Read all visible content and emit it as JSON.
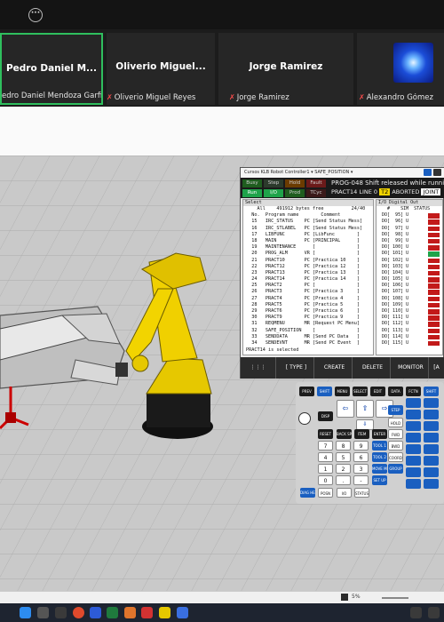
{
  "participants": [
    {
      "name": "Pedro  Daniel  M...",
      "label": "edro Daniel Mendoza Garfias",
      "muted": false
    },
    {
      "name": "Oliverio  Miguel...",
      "label": "Oliverio Miguel Reyes",
      "muted": true
    },
    {
      "name": "Jorge Ramirez",
      "label": "Jorge Ramirez",
      "muted": true
    },
    {
      "name": "",
      "label": "Alexandro Gómez",
      "muted": true
    }
  ],
  "pendant": {
    "title": "Cursos KLB   Robot Controller1 ▾   SAFE_POSITION ▾",
    "leds": [
      "Busy",
      "Step",
      "Hold",
      "Fault",
      "Run",
      "I/O",
      "Prod",
      "TCyc"
    ],
    "message1": "PROG-048 Shift released while running (P",
    "message2": "PRACT14 LINE 0",
    "t2": "T2",
    "aborted": "ABORTED",
    "joint": "JOINT",
    "select_header": "Select",
    "io_header": "I/O Digital Out",
    "prog_header": "    All    491912 bytes free          24/40",
    "prog_cols": "  No.  Program name        Comment",
    "programs": [
      "  15   IRC_STATUS    PC [Send Status Mess]",
      "  16   IRC_STLABEL   PC [Send Status Mess]",
      "  17   LIBFUNC       PC [LibFunc        ]",
      "  18   MAIN          PC [PRINCIPAL      ]",
      "  19   MAINTENANCE      [               ]",
      "  20   PROG_ALM      VR [               ]",
      "  21   PRACT10       PC [Practica 10    ]",
      "  22   PRACT12       PC [Practica 12    ]",
      "  23   PRACT13       PC [Practica 13    ]",
      "  24   PRACT14       PC [Practica 14    ]",
      "  25   PRACT2        PC [               ]",
      "  26   PRACT3        PC [Practica 3     ]",
      "  27   PRACT4        PC [Practica 4     ]",
      "  28   PRACT5        PC [Practica 5     ]",
      "  29   PRACT6        PC [Practica 6     ]",
      "  30   PRACT9        PC [Practica 9     ]",
      "  31   REQMENU       MR [Request PC Menu]",
      "  32   SAFE_POSITION    [               ]",
      "  33   SENDDATA      MR [Send PC Data   ]",
      "  34   SENDEVNT      MR [Send PC Event  ]"
    ],
    "footer": "PRACT14 is selected",
    "io_cols": "   #    SIM  STATUS",
    "io_rows": [
      {
        "text": " DO[  95] U",
        "on": false
      },
      {
        "text": " DO[  96] U",
        "on": false
      },
      {
        "text": " DO[  97] U",
        "on": false
      },
      {
        "text": " DO[  98] U",
        "on": false
      },
      {
        "text": " DO[  99] U",
        "on": false
      },
      {
        "text": " DO[ 100] U",
        "on": false
      },
      {
        "text": " DO[ 101] U",
        "on": true
      },
      {
        "text": " DO[ 102] U",
        "on": false
      },
      {
        "text": " DO[ 103] U",
        "on": false
      },
      {
        "text": " DO[ 104] U",
        "on": false
      },
      {
        "text": " DO[ 105] U",
        "on": false
      },
      {
        "text": " DO[ 106] U",
        "on": false
      },
      {
        "text": " DO[ 107] U",
        "on": false
      },
      {
        "text": " DO[ 108] U",
        "on": false
      },
      {
        "text": " DO[ 109] U",
        "on": false
      },
      {
        "text": " DO[ 110] U",
        "on": false
      },
      {
        "text": " DO[ 111] U",
        "on": false
      },
      {
        "text": " DO[ 112] U",
        "on": false
      },
      {
        "text": " DO[ 113] U",
        "on": false
      },
      {
        "text": " DO[ 114] U",
        "on": false
      },
      {
        "text": " DO[ 115] U",
        "on": false
      }
    ],
    "softkeys": [
      "⋮⋮⋮",
      "[ TYPE ]",
      "CREATE",
      "DELETE",
      "MONITOR",
      "[A"
    ]
  },
  "keypad": {
    "row1": [
      "PREV",
      "SHIFT",
      "MENU",
      "SELECT",
      "EDIT",
      "DATA",
      "FCTN",
      "SHIFT"
    ],
    "row2": [
      "DISP",
      "STEP"
    ],
    "row3": [
      "RESET",
      "BACK SPACE",
      "ITEM",
      "ENTER",
      "FWD"
    ],
    "nums": [
      [
        "7",
        "8",
        "9"
      ],
      [
        "4",
        "5",
        "6"
      ],
      [
        "1",
        "2",
        "3"
      ],
      [
        "0",
        ".",
        "-"
      ]
    ],
    "row_tool": [
      "TOOL 1",
      "TOOL 2",
      "BWD",
      "COORD"
    ],
    "row_bottom": [
      "DIAG HELP",
      "POSN",
      "I/O",
      "STATUS"
    ],
    "side": [
      "HOLD",
      "MOVE MENU",
      "SET UP",
      "GROUP"
    ]
  },
  "statusbar": {
    "zoom": "5%"
  },
  "colors": {
    "accent_green": "#1fa34a",
    "status_red": "#c21a1a",
    "keypad_blue": "#1a5fc0"
  }
}
